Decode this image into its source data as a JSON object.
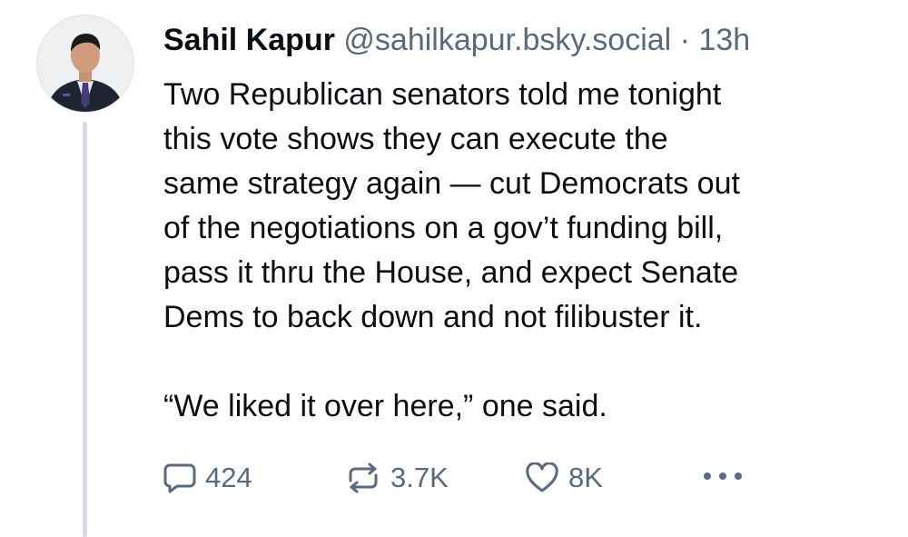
{
  "post": {
    "author": {
      "display_name": "Sahil Kapur",
      "handle": "@sahilkapur.bsky.social"
    },
    "separator": "·",
    "timestamp": "13h",
    "body": {
      "paragraph_1": "Two Republican senators told me tonight\nthis vote shows they can execute the\nsame strategy again — cut Democrats out\nof the negotiations on a gov’t funding bill,\npass it thru the House, and expect Senate\nDems to back down and not filibuster it.",
      "paragraph_2": "“We liked it over here,” one said."
    },
    "actions": {
      "reply_icon": "speech-bubble-icon",
      "reply_count": "424",
      "repost_icon": "repost-arrows-icon",
      "repost_count": "3.7K",
      "like_icon": "heart-icon",
      "like_count": "8K",
      "more_icon": "ellipsis-icon"
    }
  },
  "colors": {
    "text_primary": "#0b0f14",
    "text_secondary": "#5a6a7c",
    "thread_line": "#d4dbe2",
    "background": "#ffffff"
  }
}
